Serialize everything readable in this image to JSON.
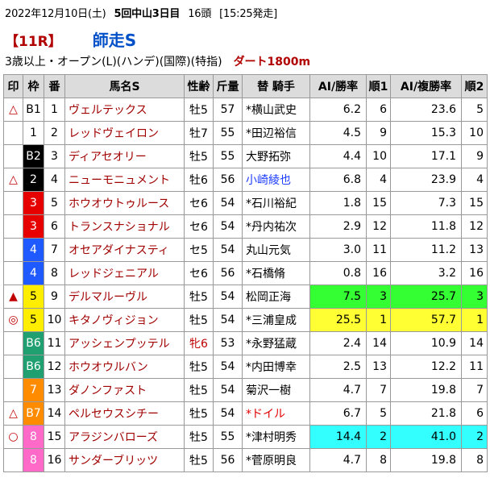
{
  "header": {
    "date": "2022年12月10日(土)",
    "meeting": "5回中山3日目",
    "runners": "16頭",
    "post_time": "[15:25発走]",
    "race_number": "【11R】",
    "race_name": "師走S",
    "conditions": "3歳以上・オープン(L)(ハンデ)(国際)(特指)",
    "surface": "ダート1800m"
  },
  "table": {
    "headers": [
      "印",
      "枠",
      "番",
      "馬名S",
      "性齢",
      "斤量",
      "替 騎手",
      "AI/勝率",
      "順1",
      "AI/複勝率",
      "順2"
    ],
    "rows": [
      {
        "mark": "△",
        "waku": "B1",
        "wc": "w1",
        "num": "1",
        "name": "ヴェルテックス",
        "sex": "牡5",
        "f": false,
        "kg": "57",
        "jockey": "*横山武史",
        "jc": "",
        "win": "6.2",
        "r1": "6",
        "place": "23.6",
        "r2": "5",
        "hl": ""
      },
      {
        "mark": "",
        "waku": "1",
        "wc": "w1",
        "num": "2",
        "name": "レッドヴェイロン",
        "sex": "牡7",
        "f": false,
        "kg": "55",
        "jockey": "*田辺裕信",
        "jc": "",
        "win": "4.5",
        "r1": "9",
        "place": "15.3",
        "r2": "10",
        "hl": ""
      },
      {
        "mark": "",
        "waku": "B2",
        "wc": "w2",
        "num": "3",
        "name": "ディアセオリー",
        "sex": "牡5",
        "f": false,
        "kg": "55",
        "jockey": "大野拓弥",
        "jc": "",
        "win": "4.4",
        "r1": "10",
        "place": "17.1",
        "r2": "9",
        "hl": ""
      },
      {
        "mark": "△",
        "waku": "2",
        "wc": "w2",
        "num": "4",
        "name": "ニューモニュメント",
        "sex": "牡6",
        "f": false,
        "kg": "56",
        "jockey": "小崎綾也",
        "jc": "j-blue",
        "win": "6.8",
        "r1": "4",
        "place": "23.9",
        "r2": "4",
        "hl": ""
      },
      {
        "mark": "",
        "waku": "3",
        "wc": "w3",
        "num": "5",
        "name": "ホウオウトゥルース",
        "sex": "セ6",
        "f": false,
        "kg": "54",
        "jockey": "*石川裕紀",
        "jc": "",
        "win": "1.8",
        "r1": "15",
        "place": "7.3",
        "r2": "15",
        "hl": ""
      },
      {
        "mark": "",
        "waku": "3",
        "wc": "w3",
        "num": "6",
        "name": "トランスナショナル",
        "sex": "セ6",
        "f": false,
        "kg": "54",
        "jockey": "*丹内祐次",
        "jc": "",
        "win": "2.9",
        "r1": "12",
        "place": "11.8",
        "r2": "12",
        "hl": ""
      },
      {
        "mark": "",
        "waku": "4",
        "wc": "w4",
        "num": "7",
        "name": "オセアダイナスティ",
        "sex": "セ5",
        "f": false,
        "kg": "54",
        "jockey": "丸山元気",
        "jc": "",
        "win": "3.0",
        "r1": "11",
        "place": "11.2",
        "r2": "13",
        "hl": ""
      },
      {
        "mark": "",
        "waku": "4",
        "wc": "w4",
        "num": "8",
        "name": "レッドジェニアル",
        "sex": "セ6",
        "f": false,
        "kg": "56",
        "jockey": "*石橋脩",
        "jc": "",
        "win": "0.8",
        "r1": "16",
        "place": "3.2",
        "r2": "16",
        "hl": ""
      },
      {
        "mark": "▲",
        "waku": "5",
        "wc": "w5",
        "num": "9",
        "name": "デルマルーヴル",
        "sex": "牡5",
        "f": false,
        "kg": "54",
        "jockey": "松岡正海",
        "jc": "",
        "win": "7.5",
        "r1": "3",
        "place": "25.7",
        "r2": "3",
        "hl": "hl-green"
      },
      {
        "mark": "◎",
        "waku": "5",
        "wc": "w5",
        "num": "10",
        "name": "キタノヴィジョン",
        "sex": "牡5",
        "f": false,
        "kg": "54",
        "jockey": "*三浦皇成",
        "jc": "",
        "win": "25.5",
        "r1": "1",
        "place": "57.7",
        "r2": "1",
        "hl": "hl-yellow"
      },
      {
        "mark": "",
        "waku": "B6",
        "wc": "w6",
        "num": "11",
        "name": "アッシェンプッテル",
        "sex": "牝6",
        "f": true,
        "kg": "53",
        "jockey": "*永野猛蔵",
        "jc": "",
        "win": "2.4",
        "r1": "14",
        "place": "10.9",
        "r2": "14",
        "hl": ""
      },
      {
        "mark": "",
        "waku": "B6",
        "wc": "w6",
        "num": "12",
        "name": "ホウオウルバン",
        "sex": "牡5",
        "f": false,
        "kg": "54",
        "jockey": "*内田博幸",
        "jc": "",
        "win": "2.5",
        "r1": "13",
        "place": "12.2",
        "r2": "11",
        "hl": ""
      },
      {
        "mark": "",
        "waku": "7",
        "wc": "w7",
        "num": "13",
        "name": "ダノンファスト",
        "sex": "牡5",
        "f": false,
        "kg": "54",
        "jockey": "菊沢一樹",
        "jc": "",
        "win": "4.7",
        "r1": "7",
        "place": "19.8",
        "r2": "7",
        "hl": ""
      },
      {
        "mark": "△",
        "waku": "B7",
        "wc": "w7",
        "num": "14",
        "name": "ペルセウスシチー",
        "sex": "牡5",
        "f": false,
        "kg": "54",
        "jockey": "*ドイル",
        "jc": "j-red",
        "win": "6.7",
        "r1": "5",
        "place": "21.8",
        "r2": "6",
        "hl": ""
      },
      {
        "mark": "○",
        "waku": "8",
        "wc": "w8",
        "num": "15",
        "name": "アラジンバローズ",
        "sex": "牡5",
        "f": false,
        "kg": "55",
        "jockey": "*津村明秀",
        "jc": "",
        "win": "14.4",
        "r1": "2",
        "place": "41.0",
        "r2": "2",
        "hl": "hl-cyan"
      },
      {
        "mark": "",
        "waku": "8",
        "wc": "w8",
        "num": "16",
        "name": "サンダーブリッツ",
        "sex": "牡5",
        "f": false,
        "kg": "56",
        "jockey": "*菅原明良",
        "jc": "",
        "win": "4.7",
        "r1": "8",
        "place": "19.8",
        "r2": "8",
        "hl": ""
      }
    ]
  }
}
